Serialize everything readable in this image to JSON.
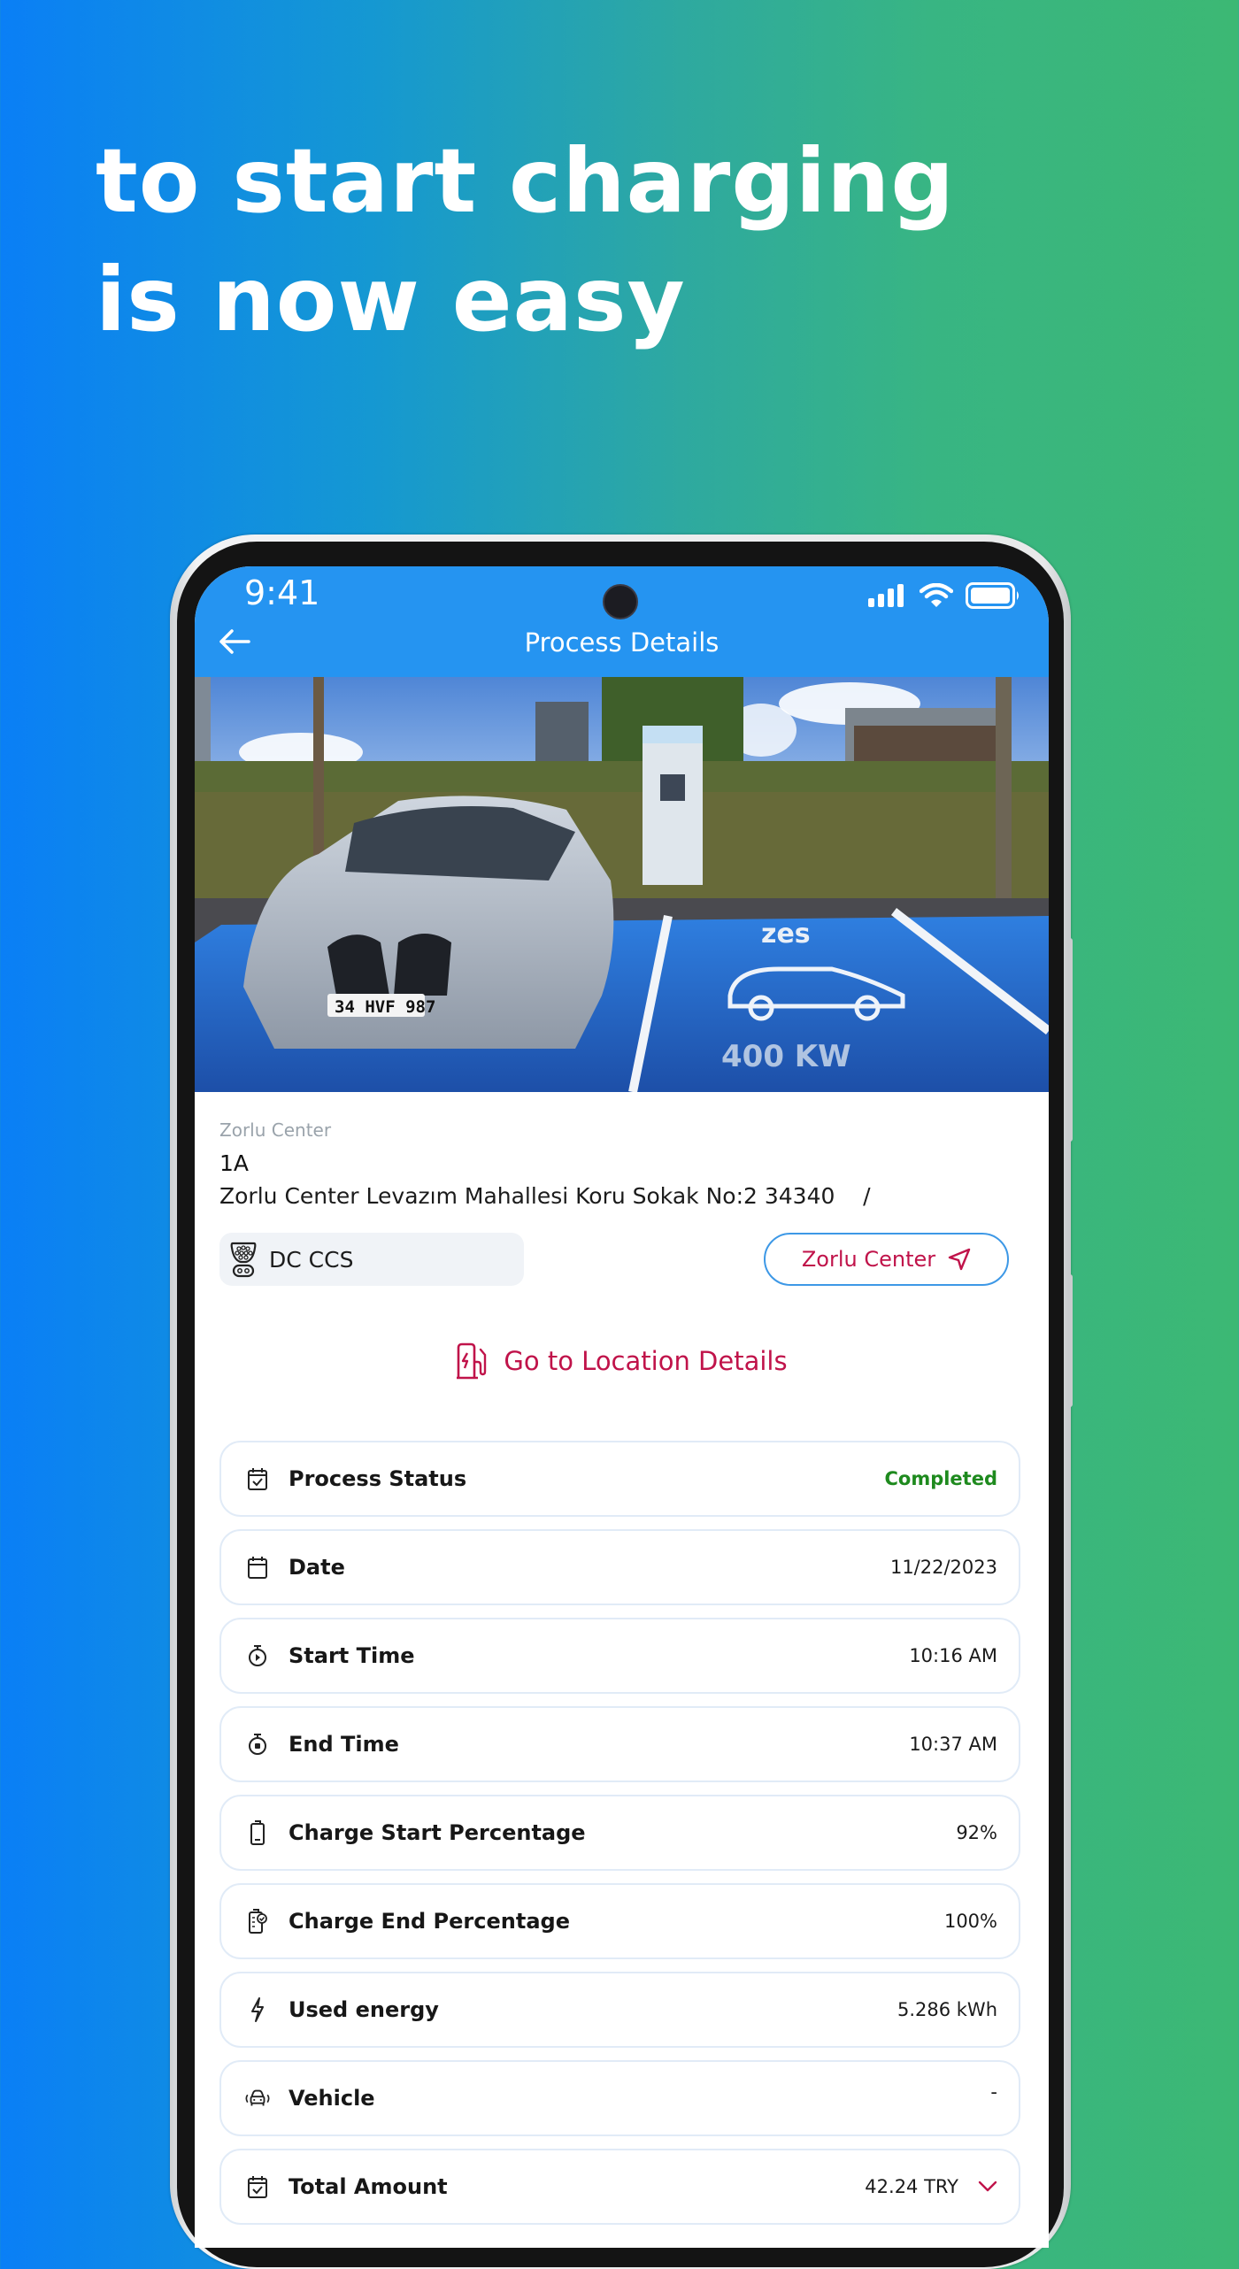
{
  "headline": {
    "line1": "to start charging",
    "line2": "is now easy"
  },
  "status_bar": {
    "time": "9:41",
    "icons": [
      "signal-icon",
      "wifi-icon",
      "battery-icon"
    ]
  },
  "app_bar": {
    "back_icon": "arrow-left-icon",
    "title": "Process Details"
  },
  "photo": {
    "description": "Car parked at ZES charging station",
    "painted_text_1": "zes",
    "painted_text_2": "400 KW",
    "plate": "34 HVF 987"
  },
  "location": {
    "name": "Zorlu Center",
    "code": "1A",
    "address": "Zorlu Center Levazım Mahallesi Koru Sokak No:2 34340    /",
    "connector": {
      "icon": "ccs-connector-icon",
      "label": "DC CCS"
    },
    "nav_button": {
      "label": "Zorlu Center",
      "icon": "navigation-arrow-icon"
    },
    "goto_link": {
      "icon": "charging-station-icon",
      "label": "Go to Location Details"
    }
  },
  "details": [
    {
      "icon": "calendar-check-icon",
      "label": "Process Status",
      "value": "Completed",
      "status": "success"
    },
    {
      "icon": "calendar-icon",
      "label": "Date",
      "value": "11/22/2023"
    },
    {
      "icon": "stopwatch-play-icon",
      "label": "Start Time",
      "value": "10:16 AM"
    },
    {
      "icon": "stopwatch-stop-icon",
      "label": "End Time",
      "value": "10:37 AM"
    },
    {
      "icon": "battery-low-icon",
      "label": "Charge Start Percentage",
      "value": "92%"
    },
    {
      "icon": "battery-check-icon",
      "label": "Charge End Percentage",
      "value": "100%"
    },
    {
      "icon": "lightning-icon",
      "label": "Used energy",
      "value": "5.286 kWh"
    },
    {
      "icon": "car-icon",
      "label": "Vehicle",
      "value": "-"
    },
    {
      "icon": "receipt-check-icon",
      "label": "Total Amount",
      "value": "42.24 TRY",
      "expandable": true
    }
  ],
  "colors": {
    "app_bar": "#2594f1",
    "accent": "#c0134a",
    "success": "#1e8a1e",
    "button_border": "#3d98e6",
    "card_border": "#e1ebf7",
    "bg_gradient_start": "#0a7ff6",
    "bg_gradient_end": "#3cb874"
  }
}
